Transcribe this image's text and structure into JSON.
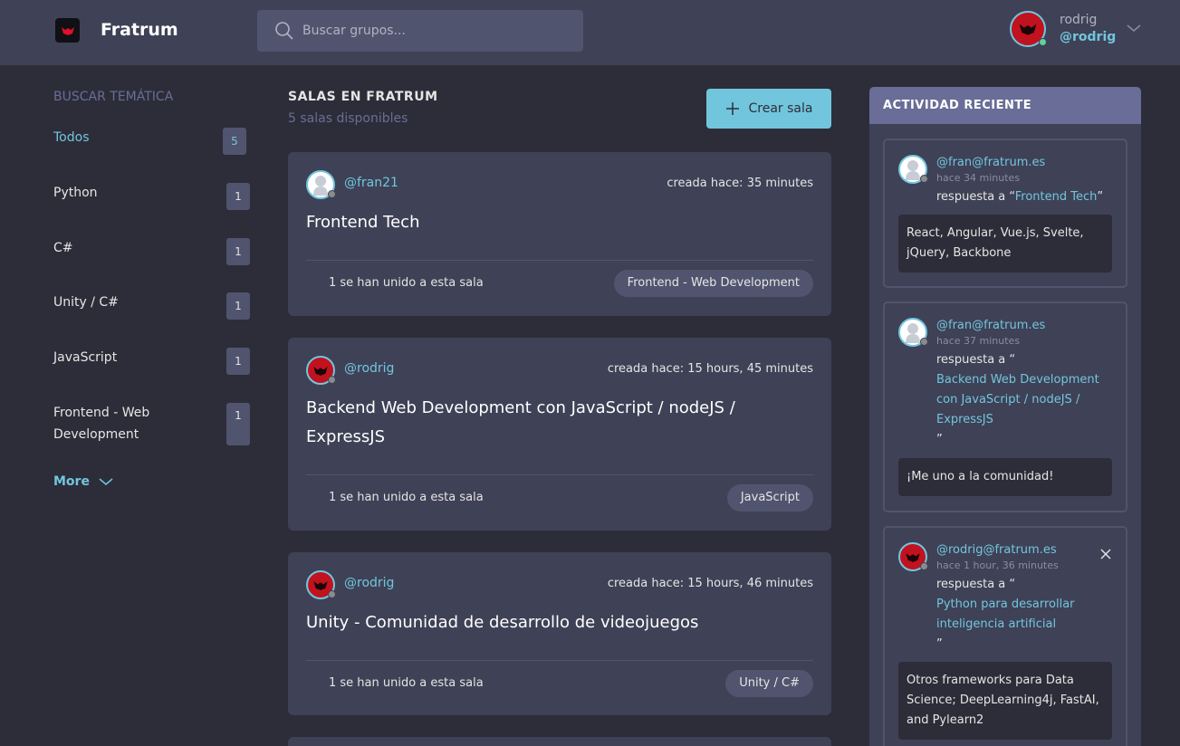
{
  "header": {
    "brand": "Fratrum",
    "search_placeholder": "Buscar grupos...",
    "user_name": "rodrig",
    "user_handle": "@rodrig"
  },
  "sidebar": {
    "title": "BUSCAR TEMÁTICA",
    "topics": [
      {
        "label": "Todos",
        "count": "5"
      },
      {
        "label": "Python",
        "count": "1"
      },
      {
        "label": "C#",
        "count": "1"
      },
      {
        "label": "Unity / C#",
        "count": "1"
      },
      {
        "label": "JavaScript",
        "count": "1"
      },
      {
        "label": "Frontend - Web Development",
        "count": "1"
      }
    ],
    "more_label": "More"
  },
  "main": {
    "title": "SALAS EN FRATRUM",
    "subtitle": "5 salas disponibles",
    "create_label": "Crear sala",
    "rooms": [
      {
        "author": "@fran21",
        "created": "creada hace: 35 minutes",
        "title": "Frontend Tech",
        "joined": "1 se han unido a esta sala",
        "tag": "Frontend - Web Development"
      },
      {
        "author": "@rodrig",
        "created": "creada hace: 15 hours, 45 minutes",
        "title": "Backend Web Development con JavaScript / nodeJS / ExpressJS",
        "joined": "1 se han unido a esta sala",
        "tag": "JavaScript"
      },
      {
        "author": "@rodrig",
        "created": "creada hace: 15 hours, 46 minutes",
        "title": "Unity - Comunidad de desarrollo de videojuegos",
        "joined": "1 se han unido a esta sala",
        "tag": "Unity / C#"
      }
    ]
  },
  "activity": {
    "title": "ACTIVIDAD RECIENTE",
    "items": [
      {
        "user": "@fran@fratrum.es",
        "time": "hace 34 minutes",
        "reply_prefix": "respuesta a “",
        "room": "Frontend Tech",
        "reply_suffix": "”",
        "message": "React, Angular, Vue.js, Svelte, jQuery, Backbone"
      },
      {
        "user": "@fran@fratrum.es",
        "time": "hace 37 minutes",
        "reply_prefix": "respuesta a “",
        "room": "Backend Web Development con JavaScript / nodeJS / ExpressJS",
        "reply_suffix": "”",
        "message": "¡Me uno a la comunidad!"
      },
      {
        "user": "@rodrig@fratrum.es",
        "time": "hace 1 hour, 36 minutes",
        "reply_prefix": "respuesta a “",
        "room": "Python para desarrollar inteligencia artificial",
        "reply_suffix": "”",
        "message": "Otros frameworks para Data Science; DeepLearning4j, FastAI, and Pylearn2"
      }
    ]
  },
  "colors": {
    "background": "#2d2d39",
    "panel": "#3f4156",
    "accent": "#71c6dd",
    "muted": "#696d97"
  }
}
